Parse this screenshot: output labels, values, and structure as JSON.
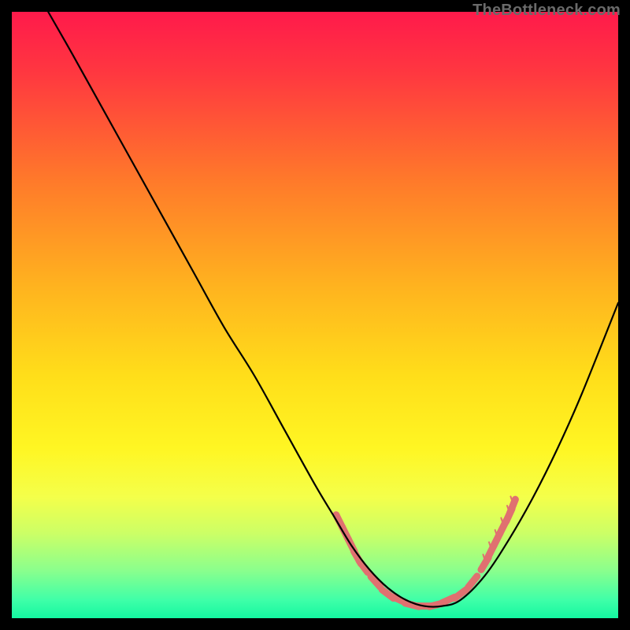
{
  "watermark": "TheBottleneck.com",
  "gradient": {
    "stops": [
      {
        "offset": 0,
        "color": "#ff1a4b"
      },
      {
        "offset": 0.1,
        "color": "#ff3740"
      },
      {
        "offset": 0.28,
        "color": "#ff7a2a"
      },
      {
        "offset": 0.45,
        "color": "#ffb21f"
      },
      {
        "offset": 0.6,
        "color": "#ffde1a"
      },
      {
        "offset": 0.72,
        "color": "#fff623"
      },
      {
        "offset": 0.8,
        "color": "#f4ff4a"
      },
      {
        "offset": 0.86,
        "color": "#ccff66"
      },
      {
        "offset": 0.92,
        "color": "#8cff8c"
      },
      {
        "offset": 0.97,
        "color": "#3fffa8"
      },
      {
        "offset": 1.0,
        "color": "#14f7a1"
      }
    ]
  },
  "chart_data": {
    "type": "line",
    "title": "",
    "xlabel": "",
    "ylabel": "",
    "xlim": [
      0,
      100
    ],
    "ylim": [
      0,
      100
    ],
    "series": [
      {
        "name": "bottleneck-curve",
        "x": [
          6,
          10,
          15,
          20,
          25,
          30,
          35,
          40,
          45,
          50,
          53,
          56,
          59,
          62,
          65,
          68,
          71,
          74,
          78,
          82,
          86,
          90,
          94,
          100
        ],
        "y": [
          100,
          93,
          84,
          75,
          66,
          57,
          48,
          40,
          31,
          22,
          17,
          12,
          8,
          5,
          3,
          2,
          2,
          3,
          7,
          13,
          20,
          28,
          37,
          52
        ]
      }
    ],
    "markers": [
      {
        "name": "pink-dash-cluster",
        "color": "#e07070",
        "points": [
          {
            "x": 54,
            "y": 16
          },
          {
            "x": 55,
            "y": 14
          },
          {
            "x": 56,
            "y": 12
          },
          {
            "x": 57,
            "y": 10
          },
          {
            "x": 58,
            "y": 8.5
          },
          {
            "x": 60,
            "y": 6
          },
          {
            "x": 62,
            "y": 4
          },
          {
            "x": 64,
            "y": 3
          },
          {
            "x": 66,
            "y": 2.2
          },
          {
            "x": 68,
            "y": 2
          },
          {
            "x": 70,
            "y": 2.2
          },
          {
            "x": 72,
            "y": 3
          },
          {
            "x": 74,
            "y": 4
          },
          {
            "x": 76,
            "y": 6
          },
          {
            "x": 78,
            "y": 9
          },
          {
            "x": 79,
            "y": 11
          },
          {
            "x": 80,
            "y": 13
          },
          {
            "x": 81,
            "y": 15
          },
          {
            "x": 82,
            "y": 17
          },
          {
            "x": 82.6,
            "y": 18.5
          }
        ]
      }
    ]
  }
}
